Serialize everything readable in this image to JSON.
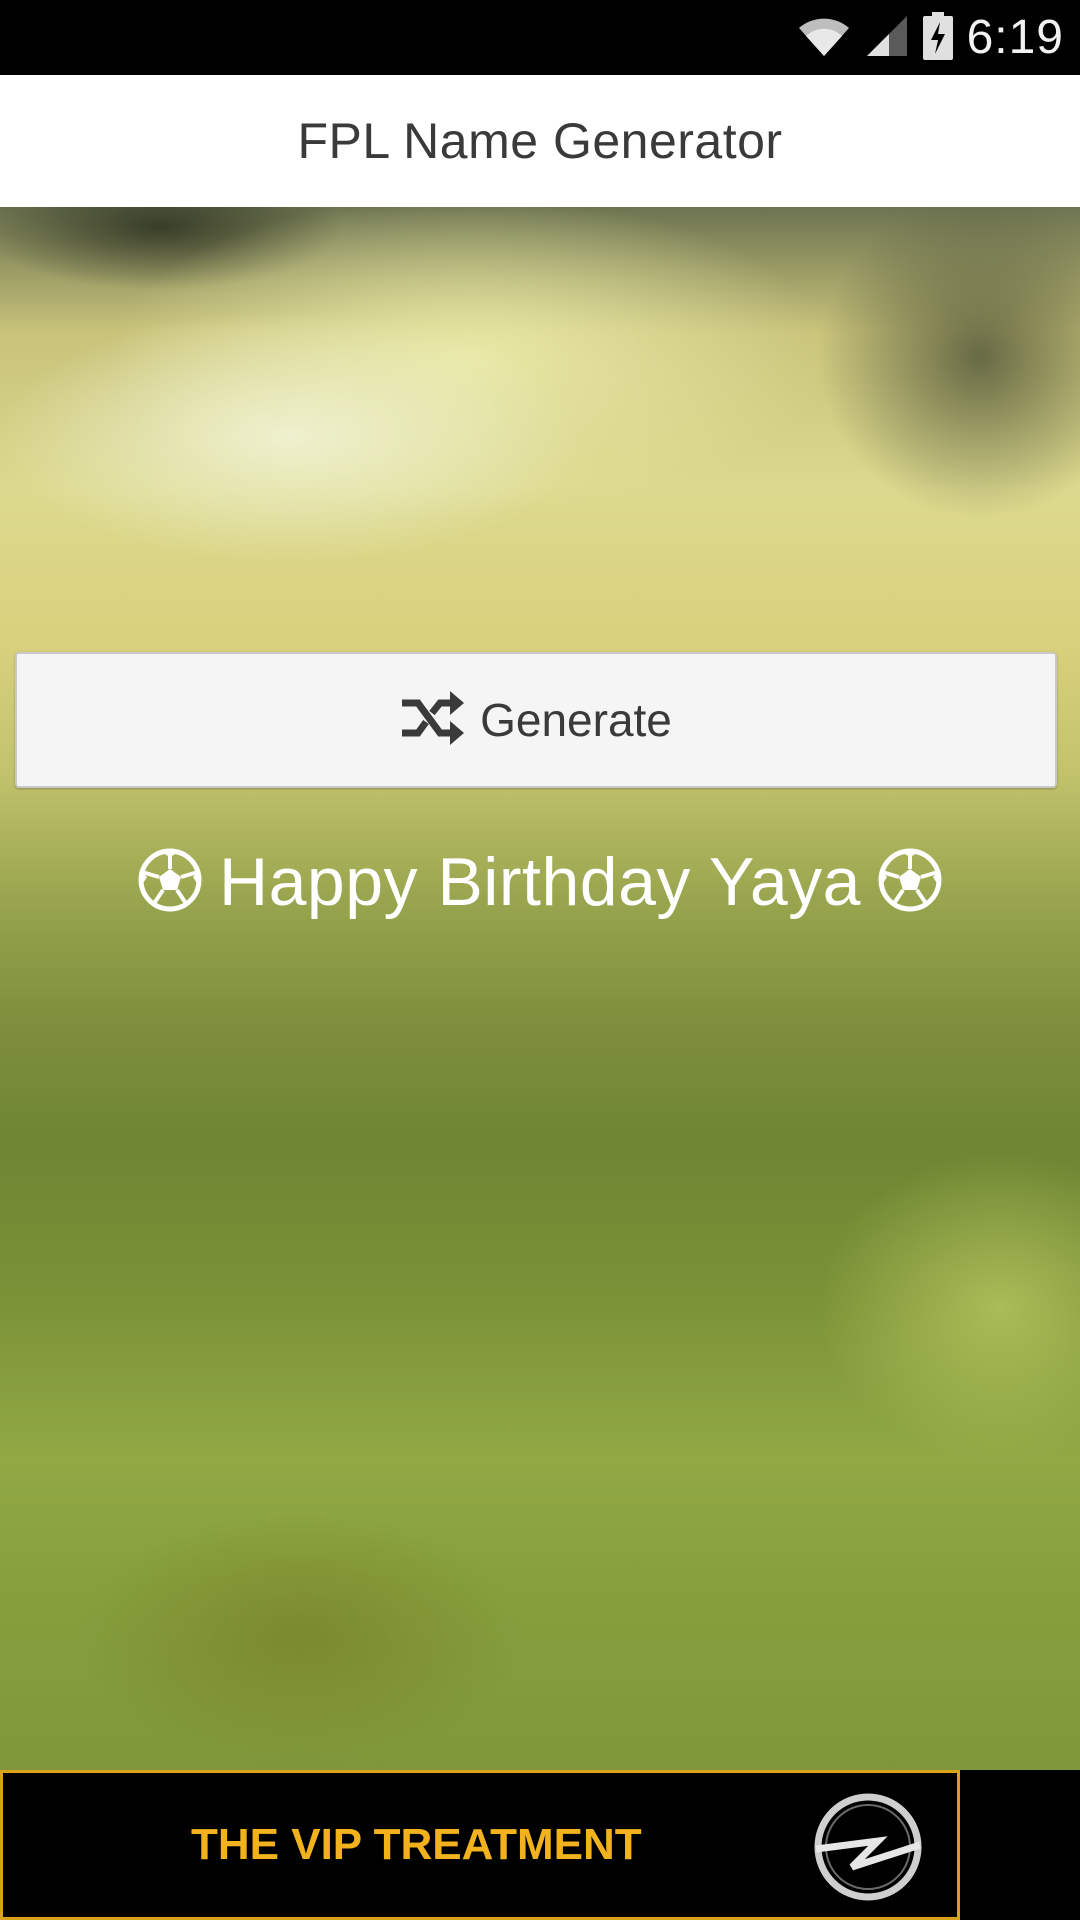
{
  "status_bar": {
    "time": "6:19",
    "icons": [
      "wifi-icon",
      "cell-signal-icon",
      "battery-charging-icon"
    ]
  },
  "action_bar": {
    "title": "FPL Name Generator"
  },
  "main": {
    "generate_button": {
      "label": "Generate",
      "icon": "shuffle-icon"
    },
    "generated_name": "Happy Birthday Yaya",
    "decorations": [
      "soccer-ball-icon",
      "soccer-ball-icon"
    ]
  },
  "ad": {
    "text": "THE VIP TREATMENT",
    "logo": "opel-logo",
    "colors": {
      "accent": "#f2b21e",
      "border": "#d9a21b",
      "background": "#000000"
    }
  },
  "colors": {
    "action_bar_bg": "#ffffff",
    "title_text": "#3a3a3a",
    "button_bg": "#f5f5f5",
    "name_text": "#ffffff"
  }
}
